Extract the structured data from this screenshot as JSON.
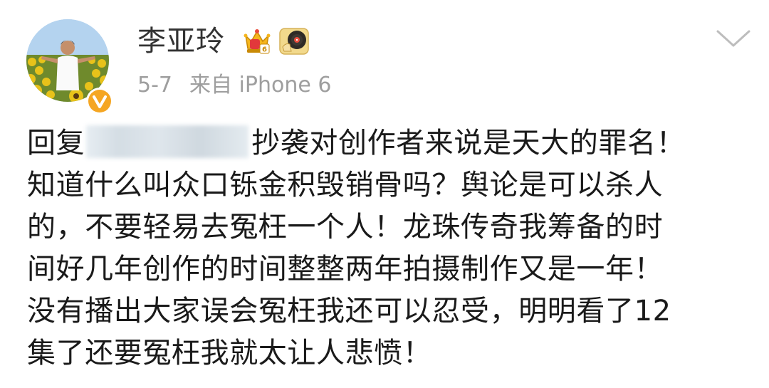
{
  "post": {
    "author": {
      "name": "李亚玲",
      "verified": true,
      "badges": [
        "crown-level-6-icon",
        "music-record-icon"
      ]
    },
    "meta": {
      "date": "5-7",
      "source": "来自 iPhone 6"
    },
    "content": {
      "lines": [
        {
          "prefix": "回复",
          "mention_blurred": true,
          "text": "抄袭对创作者来说是天大的罪名！"
        },
        {
          "text": "知道什么叫众口铄金积毁销骨吗？舆论是可以杀人"
        },
        {
          "text": "的，不要轻易去冤枉一个人！龙珠传奇我筹备的时"
        },
        {
          "text": "间好几年创作的时间整整两年拍摄制作又是一年！"
        },
        {
          "text": "没有播出大家误会冤枉我还可以忍受，明明看了12"
        },
        {
          "text": "集了还要冤枉我就太让人悲愤！"
        }
      ]
    }
  },
  "colors": {
    "username": "#333333",
    "meta": "#9e9e9e",
    "body": "#1a1a1a",
    "verified": "#f5a623",
    "chevron": "#bdbdbd"
  },
  "icons": {
    "verified": "verified-v-icon",
    "more": "chevron-down-icon"
  }
}
